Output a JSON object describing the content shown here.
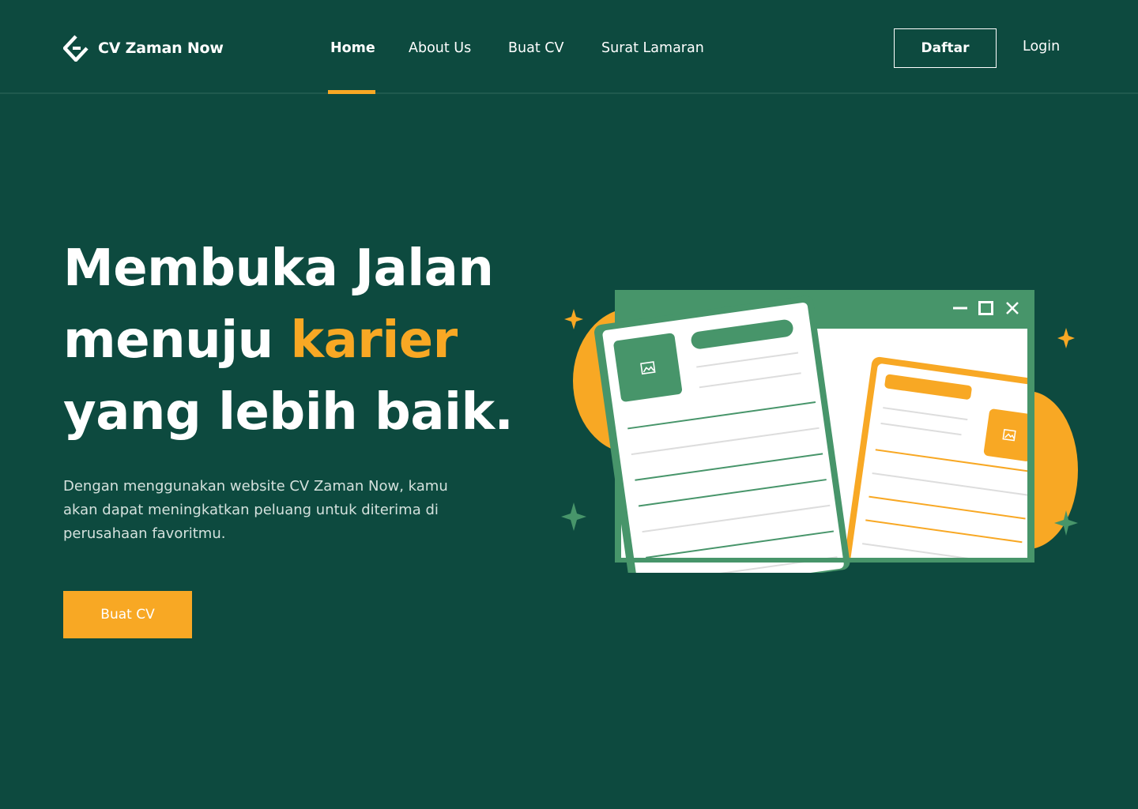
{
  "brand": {
    "name": "CV Zaman Now"
  },
  "nav": {
    "items": [
      {
        "label": "Home",
        "active": true
      },
      {
        "label": "About Us",
        "active": false
      },
      {
        "label": "Buat CV",
        "active": false
      },
      {
        "label": "Surat Lamaran",
        "active": false
      }
    ],
    "register_label": "Daftar",
    "login_label": "Login"
  },
  "hero": {
    "line1": "Membuka Jalan",
    "line2_prefix": "menuju ",
    "line2_accent": "karier",
    "line3": "yang lebih baik.",
    "description": "Dengan menggunakan website CV Zaman Now, kamu akan dapat meningkatkan peluang untuk diterima di perusahaan favoritmu.",
    "cta_label": "Buat CV"
  },
  "colors": {
    "background": "#0d4a3f",
    "accent": "#f8a824",
    "illustration_green": "#47956a"
  },
  "icons": [
    "logo-icon",
    "minimize-icon",
    "maximize-icon",
    "close-icon",
    "image-placeholder-icon",
    "sparkle-icon"
  ]
}
